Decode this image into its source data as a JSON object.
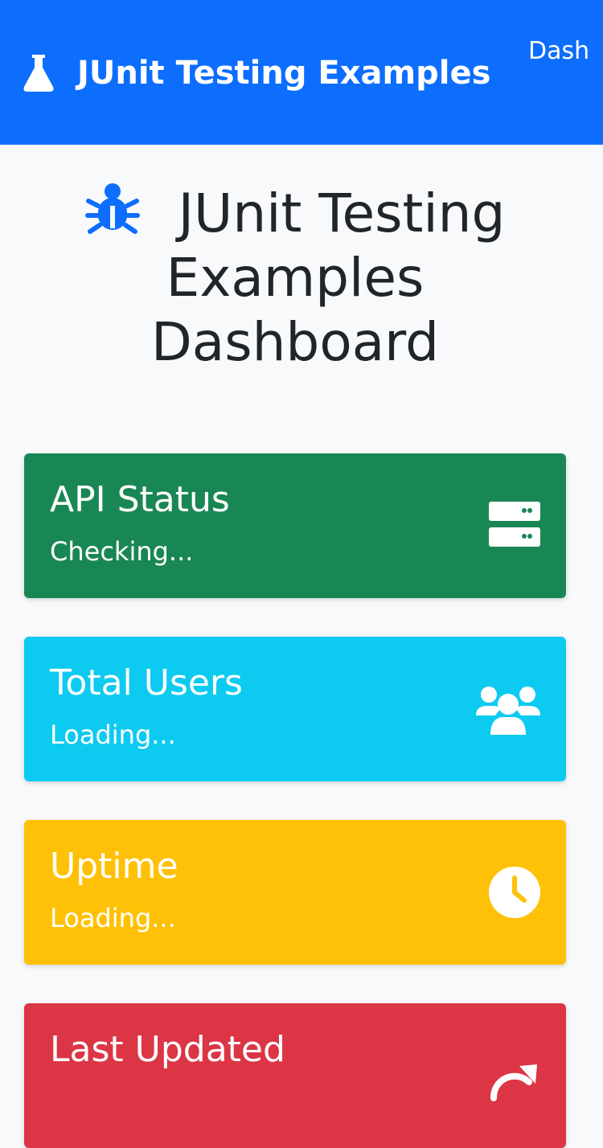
{
  "navbar": {
    "brand_icon": "flask-icon",
    "brand_text": "JUnit Testing Examples",
    "nav_link": "Dash"
  },
  "hero": {
    "icon": "bug-icon",
    "title_line1": "JUnit Testing",
    "title_line2": "Examples",
    "title_line3": "Dashboard"
  },
  "cards": [
    {
      "title": "API Status",
      "status": "Checking...",
      "icon": "server-icon",
      "color": "#198754"
    },
    {
      "title": "Total Users",
      "status": "Loading...",
      "icon": "users-icon",
      "color": "#0dcaf0"
    },
    {
      "title": "Uptime",
      "status": "Loading...",
      "icon": "clock-icon",
      "color": "#ffc107"
    },
    {
      "title": "Last Updated",
      "status": "",
      "icon": "refresh-icon",
      "color": "#dc3545"
    }
  ],
  "colors": {
    "primary": "#0d6efd",
    "background": "#f8f9fa",
    "text": "#212529"
  }
}
